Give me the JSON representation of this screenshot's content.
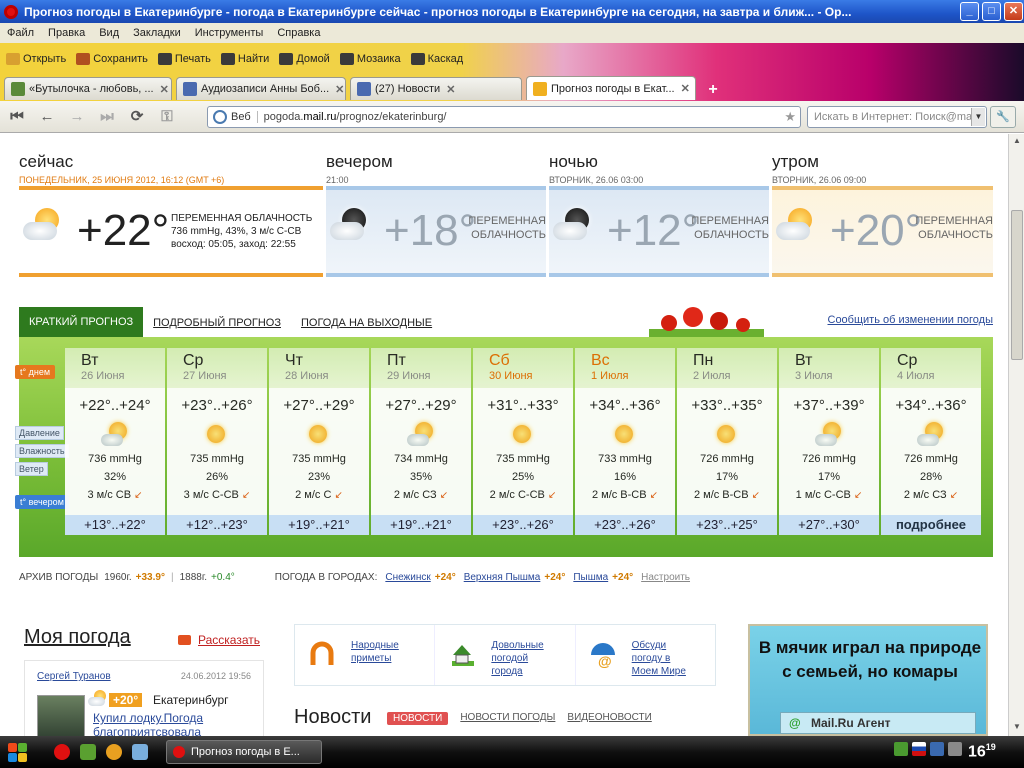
{
  "window": {
    "title": "Прогноз погоды в Екатеринбурге - погода в Екатеринбурге сейчас - прогноз погоды в Екатеринбурге на сегодня, на завтра и ближ... - Op..."
  },
  "menu": [
    "Файл",
    "Правка",
    "Вид",
    "Закладки",
    "Инструменты",
    "Справка"
  ],
  "toolbar": [
    "Открыть",
    "Сохранить",
    "Печать",
    "Найти",
    "Домой",
    "Мозаика",
    "Каскад"
  ],
  "tabs": [
    {
      "label": "«Бутылочка - любовь, ...",
      "color": "#5a8a3a"
    },
    {
      "label": "Аудиозаписи Анны Боб...",
      "color": "#4a6ab0"
    },
    {
      "label": "(27) Новости",
      "color": "#4a6ab0"
    },
    {
      "label": "Прогноз погоды в Екат...",
      "color": "#f0b020",
      "active": true
    }
  ],
  "address": {
    "label": "Веб",
    "host": "pogoda.",
    "domain": "mail.ru",
    "path": "/prognoz/ekaterinburg/"
  },
  "search": {
    "placeholder": "Искать в Интернет: Поиск@mail"
  },
  "now": [
    {
      "title": "сейчас",
      "sub": "ПОНЕДЕЛЬНИК, 25 ИЮНЯ 2012, 16:12 (GMT +6)",
      "temp": "+22°",
      "cond": "ПЕРЕМЕННАЯ ОБЛАЧНОСТЬ",
      "detail1": "736 mmHg, 43%, 3 м/с С-СВ",
      "detail2": "восход: 05:05, заход: 22:55",
      "line": "#f0a030"
    },
    {
      "title": "вечером",
      "sub": "21:00",
      "temp": "+18°",
      "cond1": "ПЕРЕМЕННАЯ",
      "cond2": "ОБЛАЧНОСТЬ",
      "line": "#a8c8e8"
    },
    {
      "title": "ночью",
      "sub": "ВТОРНИК, 26.06 03:00",
      "temp": "+12°",
      "cond1": "ПЕРЕМЕННАЯ",
      "cond2": "ОБЛАЧНОСТЬ",
      "line": "#a8c8e8"
    },
    {
      "title": "утром",
      "sub": "ВТОРНИК, 26.06 09:00",
      "temp": "+20°",
      "cond1": "ПЕРЕМЕННАЯ",
      "cond2": "ОБЛАЧНОСТЬ",
      "line": "#f0c070"
    }
  ],
  "forecast": {
    "tabs": [
      "КРАТКИЙ ПРОГНОЗ",
      "ПОДРОБНЫЙ ПРОГНОЗ",
      "ПОГОДА НА ВЫХОДНЫЕ"
    ],
    "notify": "Сообщить об изменении погоды",
    "labels": {
      "day": "t° днем",
      "pressure": "Давление",
      "humidity": "Влажность",
      "wind": "Ветер",
      "evening": "t° вечером"
    },
    "days": [
      {
        "name": "Вт",
        "date": "26 Июня",
        "temp": "+22°..+24°",
        "icon": "pc",
        "p": "736 mmHg",
        "h": "32%",
        "w": "3 м/с СВ",
        "eve": "+13°..+22°"
      },
      {
        "name": "Ср",
        "date": "27 Июня",
        "temp": "+23°..+26°",
        "icon": "sun",
        "p": "735 mmHg",
        "h": "26%",
        "w": "3 м/с С-СВ",
        "eve": "+12°..+23°"
      },
      {
        "name": "Чт",
        "date": "28 Июня",
        "temp": "+27°..+29°",
        "icon": "sun",
        "p": "735 mmHg",
        "h": "23%",
        "w": "2 м/с С",
        "eve": "+19°..+21°"
      },
      {
        "name": "Пт",
        "date": "29 Июня",
        "temp": "+27°..+29°",
        "icon": "pc",
        "p": "734 mmHg",
        "h": "35%",
        "w": "2 м/с СЗ",
        "eve": "+19°..+21°"
      },
      {
        "name": "Сб",
        "date": "30 Июня",
        "temp": "+31°..+33°",
        "icon": "sun",
        "p": "735 mmHg",
        "h": "25%",
        "w": "2 м/с С-СВ",
        "eve": "+23°..+26°",
        "we": true
      },
      {
        "name": "Вс",
        "date": "1 Июля",
        "temp": "+34°..+36°",
        "icon": "sun",
        "p": "733 mmHg",
        "h": "16%",
        "w": "2 м/с В-СВ",
        "eve": "+23°..+26°",
        "we": true
      },
      {
        "name": "Пн",
        "date": "2 Июля",
        "temp": "+33°..+35°",
        "icon": "sun",
        "p": "726 mmHg",
        "h": "17%",
        "w": "2 м/с В-СВ",
        "eve": "+23°..+25°"
      },
      {
        "name": "Вт",
        "date": "3 Июля",
        "temp": "+37°..+39°",
        "icon": "pc",
        "p": "726 mmHg",
        "h": "17%",
        "w": "1 м/с С-СВ",
        "eve": "+27°..+30°"
      },
      {
        "name": "Ср",
        "date": "4 Июля",
        "temp": "+34°..+36°",
        "icon": "pc",
        "p": "726 mmHg",
        "h": "28%",
        "w": "2 м/с СЗ",
        "eve": "подробнее"
      }
    ]
  },
  "archive": {
    "label": "АРХИВ ПОГОДЫ",
    "y1": "1960г.",
    "v1": "+33.9°",
    "y2": "1888г.",
    "v2": "+0.4°",
    "cities_label": "ПОГОДА В ГОРОДАХ:",
    "cities": [
      {
        "n": "Снежинск",
        "t": "+24°"
      },
      {
        "n": "Верхняя Пышма",
        "t": "+24°"
      },
      {
        "n": "Пышма",
        "t": "+24°"
      }
    ],
    "config": "Настроить"
  },
  "myweather": {
    "title": "Моя погода",
    "tell": "Рассказать",
    "author": "Сергей Туранов",
    "date": "24.06.2012 19:56",
    "temp": "+20°",
    "city": "Екатеринбург",
    "text": "Купил лодку.Погода благоприятсвовала"
  },
  "promo": [
    "Народные приметы",
    "Довольные погодой города",
    "Обсуди погоду в Моем Мире"
  ],
  "news": {
    "title": "Новости",
    "tabs": [
      "НОВОСТИ",
      "НОВОСТИ ПОГОДЫ",
      "ВИДЕОНОВОСТИ"
    ]
  },
  "ad": {
    "text": "В мячик играл на природе с семьей, но комары",
    "agent": "Mail.Ru Агент"
  },
  "taskbar": {
    "task": "Прогноз погоды в Е...",
    "time": "16",
    "time_min": "19"
  }
}
